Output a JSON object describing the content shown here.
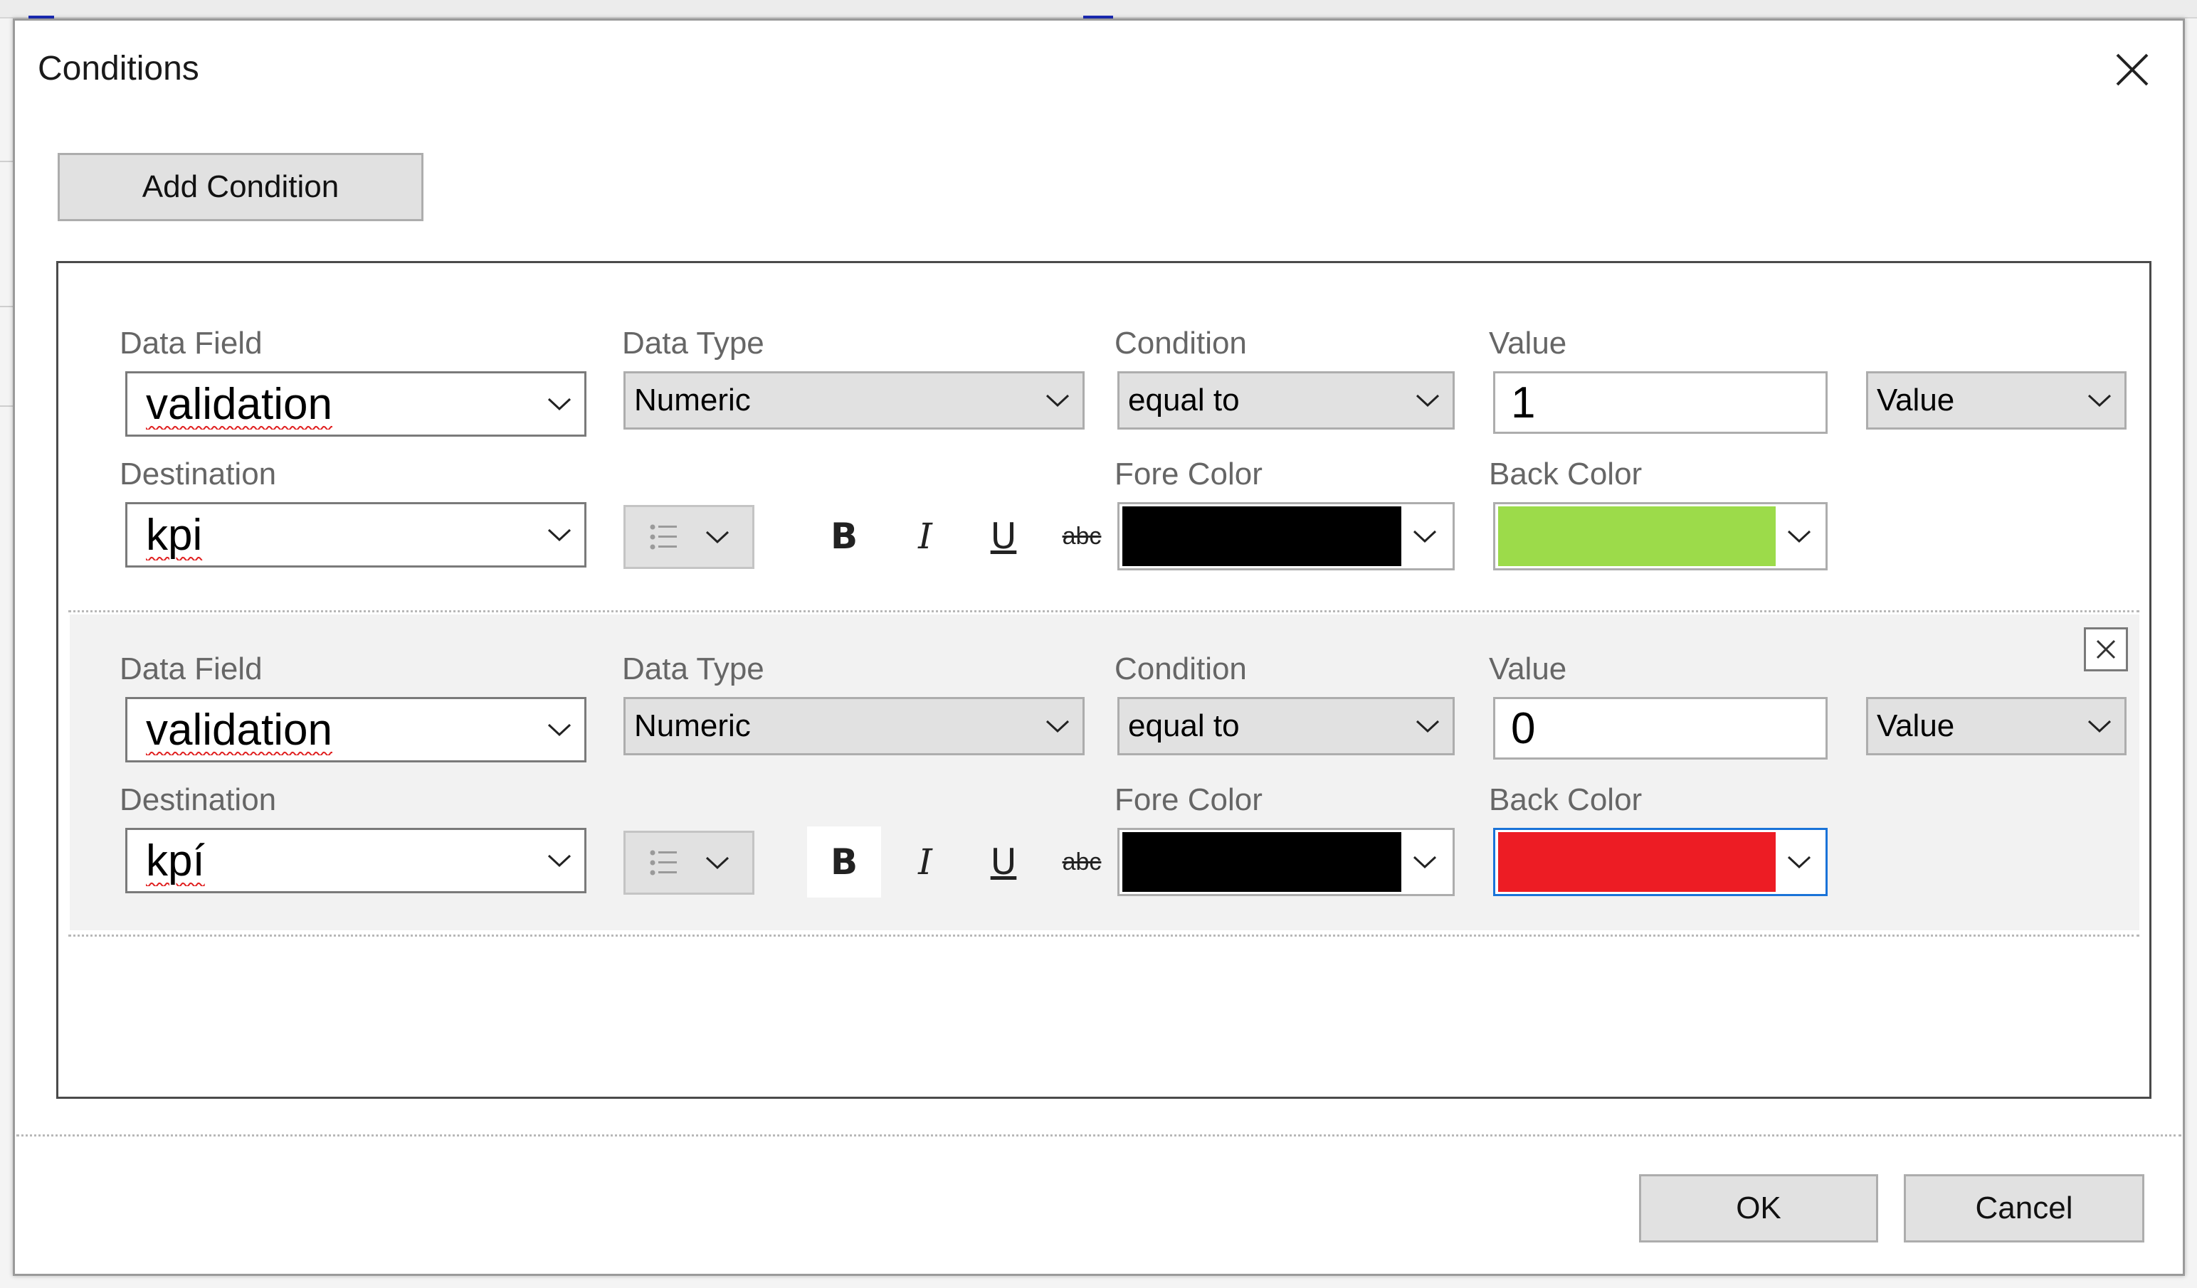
{
  "dialog": {
    "title": "Conditions",
    "add_condition_label": "Add Condition",
    "ok_label": "OK",
    "cancel_label": "Cancel"
  },
  "labels": {
    "data_field": "Data Field",
    "data_type": "Data Type",
    "condition": "Condition",
    "value": "Value",
    "destination": "Destination",
    "fore_color": "Fore Color",
    "back_color": "Back Color"
  },
  "format_buttons": {
    "bold": "B",
    "italic": "I",
    "underline": "U",
    "strikethrough": "abc"
  },
  "conditions": [
    {
      "data_field": "validation",
      "data_type": "Numeric",
      "condition": "equal to",
      "value": "1",
      "value_mode": "Value",
      "destination": "kpi",
      "fore_color": "#000000",
      "back_color": "#9cdb4a"
    },
    {
      "data_field": "validation",
      "data_type": "Numeric",
      "condition": "equal to",
      "value": "0",
      "value_mode": "Value",
      "destination": "kpí",
      "fore_color": "#000000",
      "back_color": "#ed1c24"
    }
  ],
  "icons": {
    "close": "close-icon",
    "remove_condition": "close-icon",
    "list": "bullet-list-icon",
    "dropdown": "chevron-down-icon"
  }
}
